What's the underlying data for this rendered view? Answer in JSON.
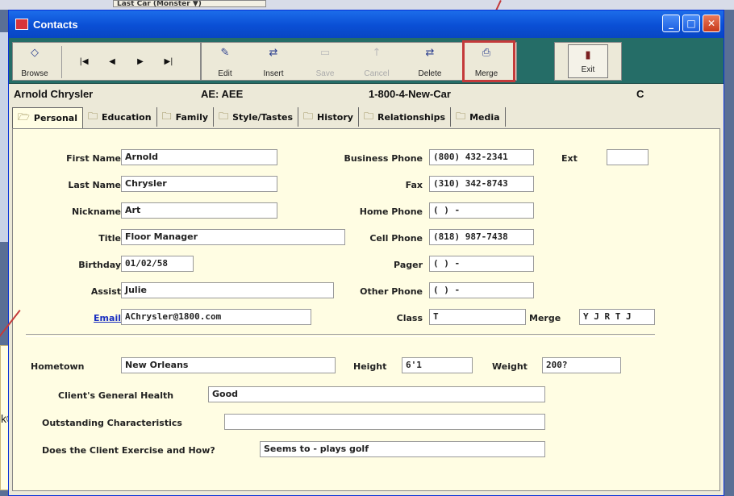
{
  "background": {
    "top_field": "Last Car (Monster ▼)",
    "callout_text": "k®."
  },
  "window": {
    "title": "Contacts",
    "controls": {
      "minimize": "_",
      "maximize": "□",
      "close": "✕"
    }
  },
  "toolbar": {
    "browse": "Browse",
    "nav": {
      "first": "|◀",
      "prev": "◀",
      "next": "▶",
      "last": "▶|"
    },
    "edit": "Edit",
    "insert": "Insert",
    "save": "Save",
    "cancel": "Cancel",
    "delete": "Delete",
    "merge": "Merge",
    "exit": "Exit"
  },
  "info": {
    "name": "Arnold Chrysler",
    "ae": "AE: AEE",
    "phone": "1-800-4-New-Car",
    "code": "C"
  },
  "tabs": [
    "Personal",
    "Education",
    "Family",
    "Style/Tastes",
    "History",
    "Relationships",
    "Media"
  ],
  "form": {
    "first_name": {
      "label": "First Name",
      "value": "Arnold"
    },
    "last_name": {
      "label": "Last Name",
      "value": "Chrysler"
    },
    "nickname": {
      "label": "Nickname",
      "value": "Art"
    },
    "title": {
      "label": "Title",
      "value": "Floor Manager"
    },
    "birthday": {
      "label": "Birthday",
      "value": "01/02/58"
    },
    "assist": {
      "label": "Assist",
      "value": "Julie"
    },
    "email": {
      "label": "Email",
      "value": "AChrysler@1800.com"
    },
    "business_phone": {
      "label": "Business Phone",
      "value": "(800) 432-2341"
    },
    "ext": {
      "label": "Ext",
      "value": ""
    },
    "fax": {
      "label": "Fax",
      "value": "(310) 342-8743"
    },
    "home_phone": {
      "label": "Home Phone",
      "value": "(  )  -"
    },
    "cell_phone": {
      "label": "Cell Phone",
      "value": "(818) 987-7438"
    },
    "pager": {
      "label": "Pager",
      "value": "(  )  -"
    },
    "other_phone": {
      "label": "Other Phone",
      "value": "(  )  -"
    },
    "class": {
      "label": "Class",
      "value": "T"
    },
    "merge": {
      "label": "Merge",
      "value": "Y J R T J"
    },
    "hometown": {
      "label": "Hometown",
      "value": "New Orleans"
    },
    "height": {
      "label": "Height",
      "value": "6'1"
    },
    "weight": {
      "label": "Weight",
      "value": "200?"
    },
    "general_health": {
      "label": "Client's General Health",
      "value": "Good"
    },
    "outstanding": {
      "label": "Outstanding Characteristics",
      "value": ""
    },
    "exercise": {
      "label": "Does the Client Exercise and How?",
      "value": "Seems to - plays golf"
    }
  }
}
